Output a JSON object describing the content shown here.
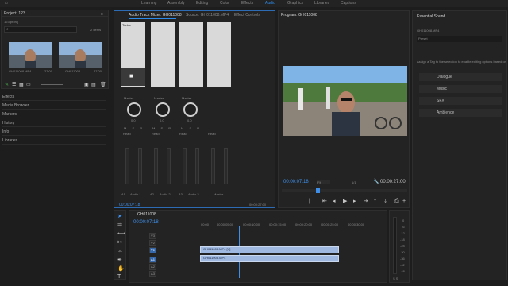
{
  "workspaces": [
    "Learning",
    "Assembly",
    "Editing",
    "Color",
    "Effects",
    "Audio",
    "Graphics",
    "Libraries",
    "Captions"
  ],
  "active_workspace": "Audio",
  "project": {
    "title": "Project: 123",
    "file": "123.prproj",
    "item_count": "2 Items",
    "items": [
      {
        "name": "GH011008.MP4",
        "duration": "27:00"
      },
      {
        "name": "GH011008",
        "duration": "27:00"
      }
    ],
    "panels": [
      "Effects",
      "Media Browser",
      "Markers",
      "History",
      "Info",
      "Libraries"
    ]
  },
  "mixer": {
    "tabs": [
      "Audio Track Mixer: GH011008",
      "Source: GH011008.MP4",
      "Effect Controls"
    ],
    "master_label": "Master",
    "read_label": "Read",
    "pan_value": "0.0",
    "tracks": [
      {
        "id": "A1",
        "name": "Audio 1"
      },
      {
        "id": "A2",
        "name": "Audio 2"
      },
      {
        "id": "A3",
        "name": "Audio 3"
      },
      {
        "id": "",
        "name": "Master"
      }
    ],
    "first_insert": "Treble",
    "timecode_left": "00:00:07:18",
    "timecode_right": "00:00:27:00"
  },
  "program": {
    "title": "Program: GH011008",
    "timecode": "00:00:07:18",
    "fit": "Fit",
    "quality": "1/1",
    "duration": "00:00:27:00"
  },
  "essential_sound": {
    "title": "Essential Sound",
    "clip": "GH011008.MP4",
    "preset_label": "Preset",
    "hint": "Assign a Tag to the selection to enable editing options based on the type",
    "buttons": [
      "Dialogue",
      "Music",
      "SFX",
      "Ambience"
    ]
  },
  "timeline": {
    "tab": "GH011008",
    "timecode": "00:00:07:18",
    "ruler": [
      "00:00",
      "00:00:05:00",
      "00:00:10:00",
      "00:00:15:00",
      "00:00:20:00",
      "00:00:25:00",
      "00:00:30:00"
    ],
    "video_tracks": [
      "V3",
      "V2",
      "V1"
    ],
    "audio_tracks": [
      "A1",
      "A2",
      "A3"
    ],
    "video_clip": "GH011008.MP4 [V]",
    "audio_clip": "GH011008.MP4"
  },
  "meter_scale": [
    "0",
    "-6",
    "-12",
    "-18",
    "-24",
    "-30",
    "-36",
    "-42",
    "-48",
    "-54"
  ],
  "meter_footer": "S S"
}
